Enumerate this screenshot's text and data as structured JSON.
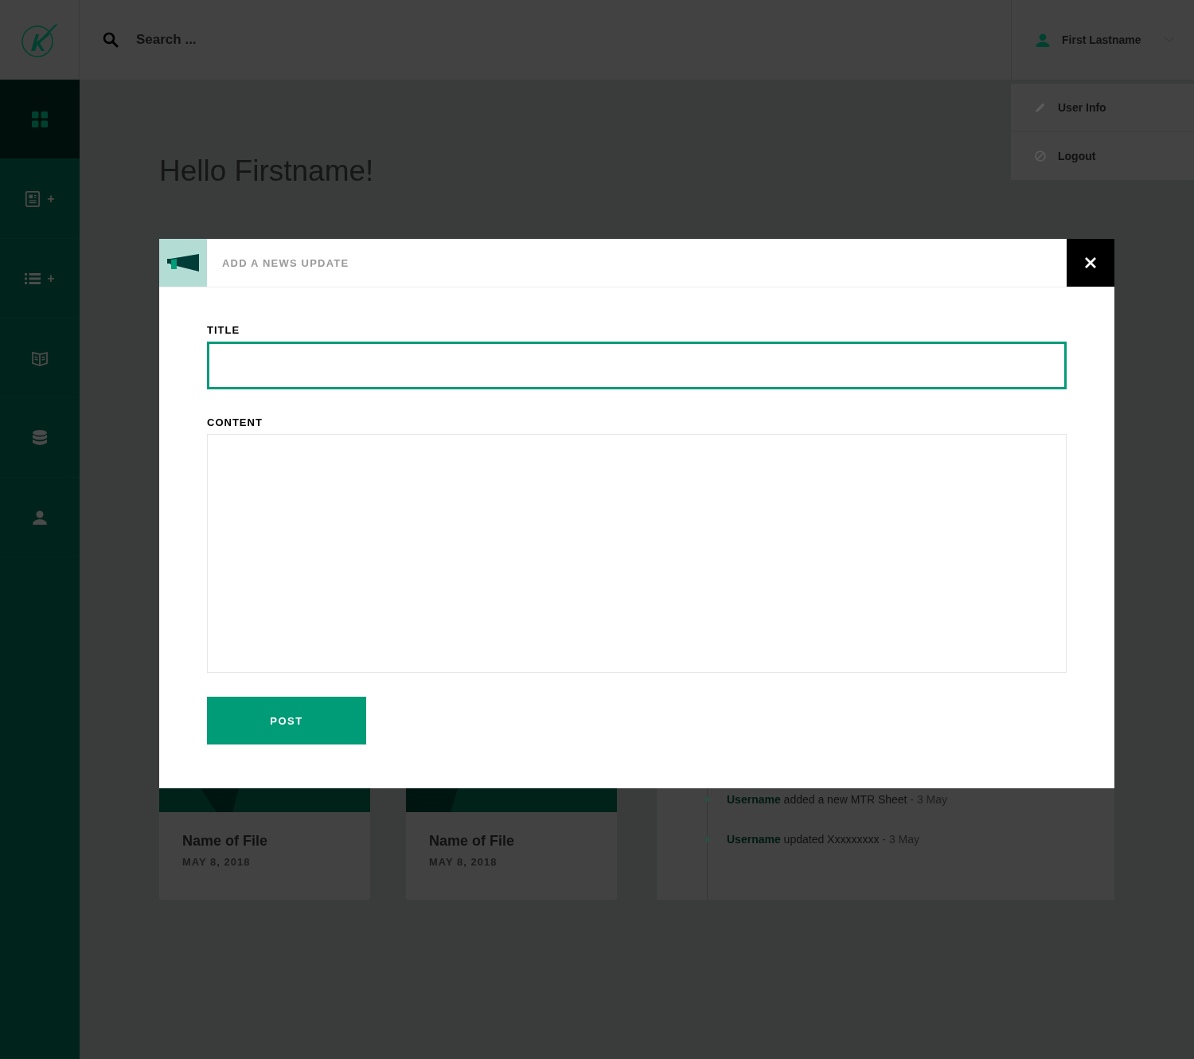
{
  "header": {
    "search": {
      "placeholder": "Search ..."
    },
    "user": {
      "name": "First Lastname"
    },
    "user_menu": [
      {
        "kind": "edit",
        "label": "User Info"
      },
      {
        "kind": "logout",
        "label": "Logout"
      }
    ]
  },
  "sidebar": {
    "items": [
      {
        "kind": "dashboard",
        "selected": true
      },
      {
        "kind": "news",
        "selected": false,
        "badge": "+"
      },
      {
        "kind": "list",
        "selected": false,
        "badge": "+"
      },
      {
        "kind": "book",
        "selected": false
      },
      {
        "kind": "database",
        "selected": false
      },
      {
        "kind": "user",
        "selected": false
      }
    ]
  },
  "greeting": "Hello Firstname!",
  "modal": {
    "title": "ADD A NEWS UPDATE",
    "fields": [
      {
        "kind": "input",
        "label": "TITLE",
        "focused": true
      },
      {
        "kind": "textarea",
        "label": "CONTENT",
        "focused": false
      }
    ],
    "submit": "POST"
  },
  "files": [
    {
      "name": "Name of File",
      "date": "MAY 8, 2018"
    },
    {
      "name": "Name of File",
      "date": "MAY 8, 2018"
    }
  ],
  "activity": [
    {
      "user": "Username",
      "action": "added a new MTR Sheet",
      "time": "- 3 May"
    },
    {
      "user": "Username",
      "action": "updated Xxxxxxxxx",
      "time": "- 3 May"
    }
  ]
}
